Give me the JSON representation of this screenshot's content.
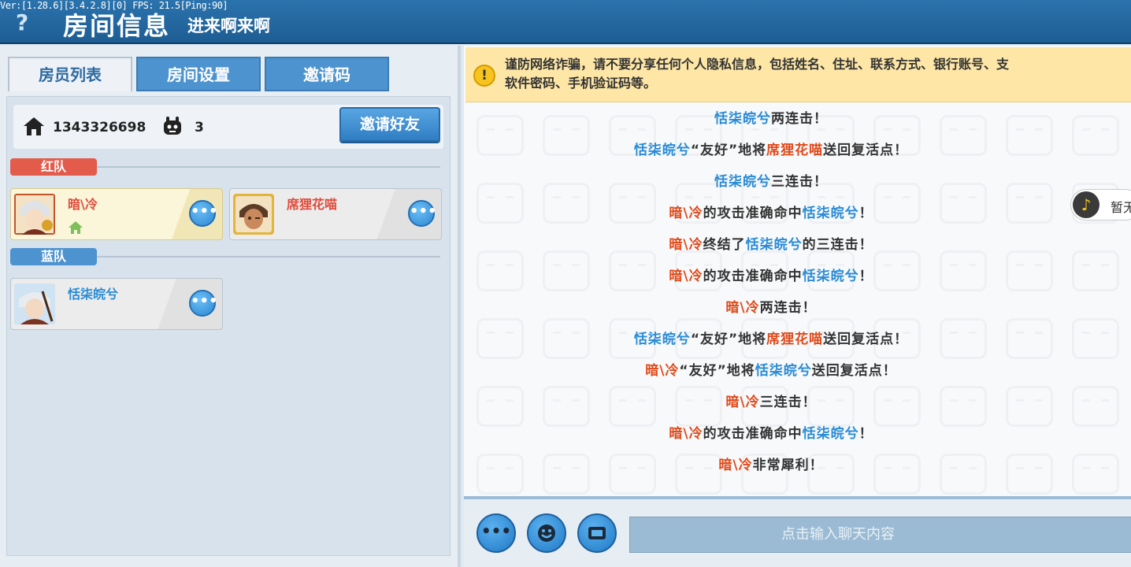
{
  "header": {
    "version": "Ver:[1.28.6][3.4.2.8][0] FPS: 21.5[Ping:90]",
    "help": "?",
    "title": "房间信息",
    "room_name": "进来啊来啊"
  },
  "tabs": [
    {
      "label": "房员列表",
      "active": true
    },
    {
      "label": "房间设置",
      "active": false
    },
    {
      "label": "邀请码",
      "active": false
    }
  ],
  "room": {
    "id": "1343326698",
    "player_count": "3",
    "invite_button": "邀请好友"
  },
  "teams": {
    "red": {
      "label": "红队",
      "players": [
        {
          "name": "暗\\冷",
          "is_self": true
        },
        {
          "name": "席狸花喵",
          "is_self": false
        }
      ]
    },
    "blue": {
      "label": "蓝队",
      "players": [
        {
          "name": "恬柒皖兮",
          "is_self": false
        }
      ]
    }
  },
  "more_button": "•••",
  "warning": "谨防网络诈骗，请不要分享任何个人隐私信息，包括姓名、住址、联系方式、银行账号、支\n软件密码、手机验证码等。",
  "chat": [
    [
      {
        "t": "恬柒皖兮",
        "c": "blue"
      },
      {
        "t": "两连击！",
        "c": ""
      }
    ],
    [
      {
        "t": "恬柒皖兮",
        "c": "blue"
      },
      {
        "t": "“友好”地将",
        "c": ""
      },
      {
        "t": "席狸花喵",
        "c": "red"
      },
      {
        "t": "送回复活点！",
        "c": ""
      }
    ],
    [
      {
        "t": "恬柒皖兮",
        "c": "blue"
      },
      {
        "t": "三连击！",
        "c": ""
      }
    ],
    [
      {
        "t": "暗\\冷",
        "c": "red"
      },
      {
        "t": "的攻击准确命中",
        "c": ""
      },
      {
        "t": "恬柒皖兮",
        "c": "blue"
      },
      {
        "t": "！",
        "c": ""
      }
    ],
    [
      {
        "t": "暗\\冷",
        "c": "red"
      },
      {
        "t": "终结了",
        "c": ""
      },
      {
        "t": "恬柒皖兮",
        "c": "blue"
      },
      {
        "t": "的三连击！",
        "c": ""
      }
    ],
    [
      {
        "t": "暗\\冷",
        "c": "red"
      },
      {
        "t": "的攻击准确命中",
        "c": ""
      },
      {
        "t": "恬柒皖兮",
        "c": "blue"
      },
      {
        "t": "！",
        "c": ""
      }
    ],
    [
      {
        "t": "暗\\冷",
        "c": "red"
      },
      {
        "t": "两连击！",
        "c": ""
      }
    ],
    [
      {
        "t": "恬柒皖兮",
        "c": "blue"
      },
      {
        "t": "“友好”地将",
        "c": ""
      },
      {
        "t": "席狸花喵",
        "c": "red"
      },
      {
        "t": "送回复活点！",
        "c": ""
      }
    ],
    [
      {
        "t": "暗\\冷",
        "c": "red"
      },
      {
        "t": "“友好”地将",
        "c": ""
      },
      {
        "t": "恬柒皖兮",
        "c": "blue"
      },
      {
        "t": "送回复活点！",
        "c": ""
      }
    ],
    [
      {
        "t": "暗\\冷",
        "c": "red"
      },
      {
        "t": "三连击！",
        "c": ""
      }
    ],
    [
      {
        "t": "暗\\冷",
        "c": "red"
      },
      {
        "t": "的攻击准确命中",
        "c": ""
      },
      {
        "t": "恬柒皖兮",
        "c": "blue"
      },
      {
        "t": "！",
        "c": ""
      }
    ],
    [
      {
        "t": "暗\\冷",
        "c": "red"
      },
      {
        "t": "非常犀利！",
        "c": ""
      }
    ]
  ],
  "music": {
    "label": "暂无",
    "icon": "music-note-icon"
  },
  "input": {
    "placeholder": "点击输入聊天内容"
  },
  "colors": {
    "red": "#e04a1a",
    "blue": "#2a8bd6",
    "header": "#1d5d93"
  }
}
